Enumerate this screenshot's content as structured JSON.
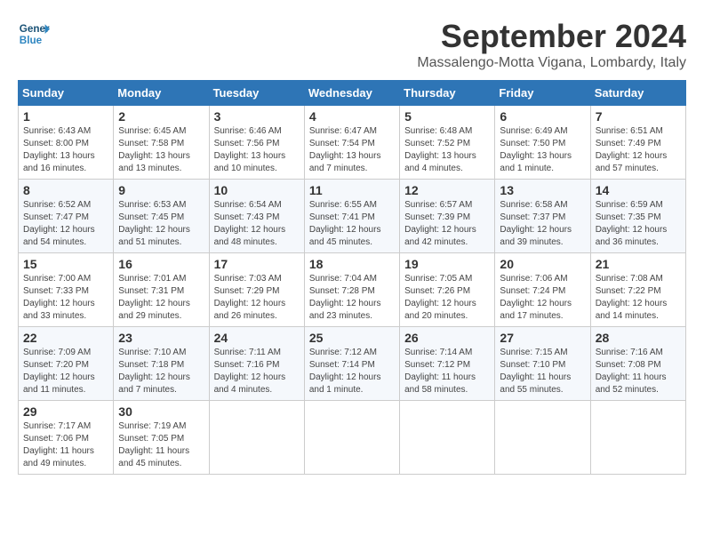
{
  "header": {
    "logo_line1": "General",
    "logo_line2": "Blue",
    "month_title": "September 2024",
    "location": "Massalengo-Motta Vigana, Lombardy, Italy"
  },
  "columns": [
    "Sunday",
    "Monday",
    "Tuesday",
    "Wednesday",
    "Thursday",
    "Friday",
    "Saturday"
  ],
  "weeks": [
    [
      {
        "day": "1",
        "info": "Sunrise: 6:43 AM\nSunset: 8:00 PM\nDaylight: 13 hours\nand 16 minutes."
      },
      {
        "day": "2",
        "info": "Sunrise: 6:45 AM\nSunset: 7:58 PM\nDaylight: 13 hours\nand 13 minutes."
      },
      {
        "day": "3",
        "info": "Sunrise: 6:46 AM\nSunset: 7:56 PM\nDaylight: 13 hours\nand 10 minutes."
      },
      {
        "day": "4",
        "info": "Sunrise: 6:47 AM\nSunset: 7:54 PM\nDaylight: 13 hours\nand 7 minutes."
      },
      {
        "day": "5",
        "info": "Sunrise: 6:48 AM\nSunset: 7:52 PM\nDaylight: 13 hours\nand 4 minutes."
      },
      {
        "day": "6",
        "info": "Sunrise: 6:49 AM\nSunset: 7:50 PM\nDaylight: 13 hours\nand 1 minute."
      },
      {
        "day": "7",
        "info": "Sunrise: 6:51 AM\nSunset: 7:49 PM\nDaylight: 12 hours\nand 57 minutes."
      }
    ],
    [
      {
        "day": "8",
        "info": "Sunrise: 6:52 AM\nSunset: 7:47 PM\nDaylight: 12 hours\nand 54 minutes."
      },
      {
        "day": "9",
        "info": "Sunrise: 6:53 AM\nSunset: 7:45 PM\nDaylight: 12 hours\nand 51 minutes."
      },
      {
        "day": "10",
        "info": "Sunrise: 6:54 AM\nSunset: 7:43 PM\nDaylight: 12 hours\nand 48 minutes."
      },
      {
        "day": "11",
        "info": "Sunrise: 6:55 AM\nSunset: 7:41 PM\nDaylight: 12 hours\nand 45 minutes."
      },
      {
        "day": "12",
        "info": "Sunrise: 6:57 AM\nSunset: 7:39 PM\nDaylight: 12 hours\nand 42 minutes."
      },
      {
        "day": "13",
        "info": "Sunrise: 6:58 AM\nSunset: 7:37 PM\nDaylight: 12 hours\nand 39 minutes."
      },
      {
        "day": "14",
        "info": "Sunrise: 6:59 AM\nSunset: 7:35 PM\nDaylight: 12 hours\nand 36 minutes."
      }
    ],
    [
      {
        "day": "15",
        "info": "Sunrise: 7:00 AM\nSunset: 7:33 PM\nDaylight: 12 hours\nand 33 minutes."
      },
      {
        "day": "16",
        "info": "Sunrise: 7:01 AM\nSunset: 7:31 PM\nDaylight: 12 hours\nand 29 minutes."
      },
      {
        "day": "17",
        "info": "Sunrise: 7:03 AM\nSunset: 7:29 PM\nDaylight: 12 hours\nand 26 minutes."
      },
      {
        "day": "18",
        "info": "Sunrise: 7:04 AM\nSunset: 7:28 PM\nDaylight: 12 hours\nand 23 minutes."
      },
      {
        "day": "19",
        "info": "Sunrise: 7:05 AM\nSunset: 7:26 PM\nDaylight: 12 hours\nand 20 minutes."
      },
      {
        "day": "20",
        "info": "Sunrise: 7:06 AM\nSunset: 7:24 PM\nDaylight: 12 hours\nand 17 minutes."
      },
      {
        "day": "21",
        "info": "Sunrise: 7:08 AM\nSunset: 7:22 PM\nDaylight: 12 hours\nand 14 minutes."
      }
    ],
    [
      {
        "day": "22",
        "info": "Sunrise: 7:09 AM\nSunset: 7:20 PM\nDaylight: 12 hours\nand 11 minutes."
      },
      {
        "day": "23",
        "info": "Sunrise: 7:10 AM\nSunset: 7:18 PM\nDaylight: 12 hours\nand 7 minutes."
      },
      {
        "day": "24",
        "info": "Sunrise: 7:11 AM\nSunset: 7:16 PM\nDaylight: 12 hours\nand 4 minutes."
      },
      {
        "day": "25",
        "info": "Sunrise: 7:12 AM\nSunset: 7:14 PM\nDaylight: 12 hours\nand 1 minute."
      },
      {
        "day": "26",
        "info": "Sunrise: 7:14 AM\nSunset: 7:12 PM\nDaylight: 11 hours\nand 58 minutes."
      },
      {
        "day": "27",
        "info": "Sunrise: 7:15 AM\nSunset: 7:10 PM\nDaylight: 11 hours\nand 55 minutes."
      },
      {
        "day": "28",
        "info": "Sunrise: 7:16 AM\nSunset: 7:08 PM\nDaylight: 11 hours\nand 52 minutes."
      }
    ],
    [
      {
        "day": "29",
        "info": "Sunrise: 7:17 AM\nSunset: 7:06 PM\nDaylight: 11 hours\nand 49 minutes."
      },
      {
        "day": "30",
        "info": "Sunrise: 7:19 AM\nSunset: 7:05 PM\nDaylight: 11 hours\nand 45 minutes."
      },
      null,
      null,
      null,
      null,
      null
    ]
  ]
}
